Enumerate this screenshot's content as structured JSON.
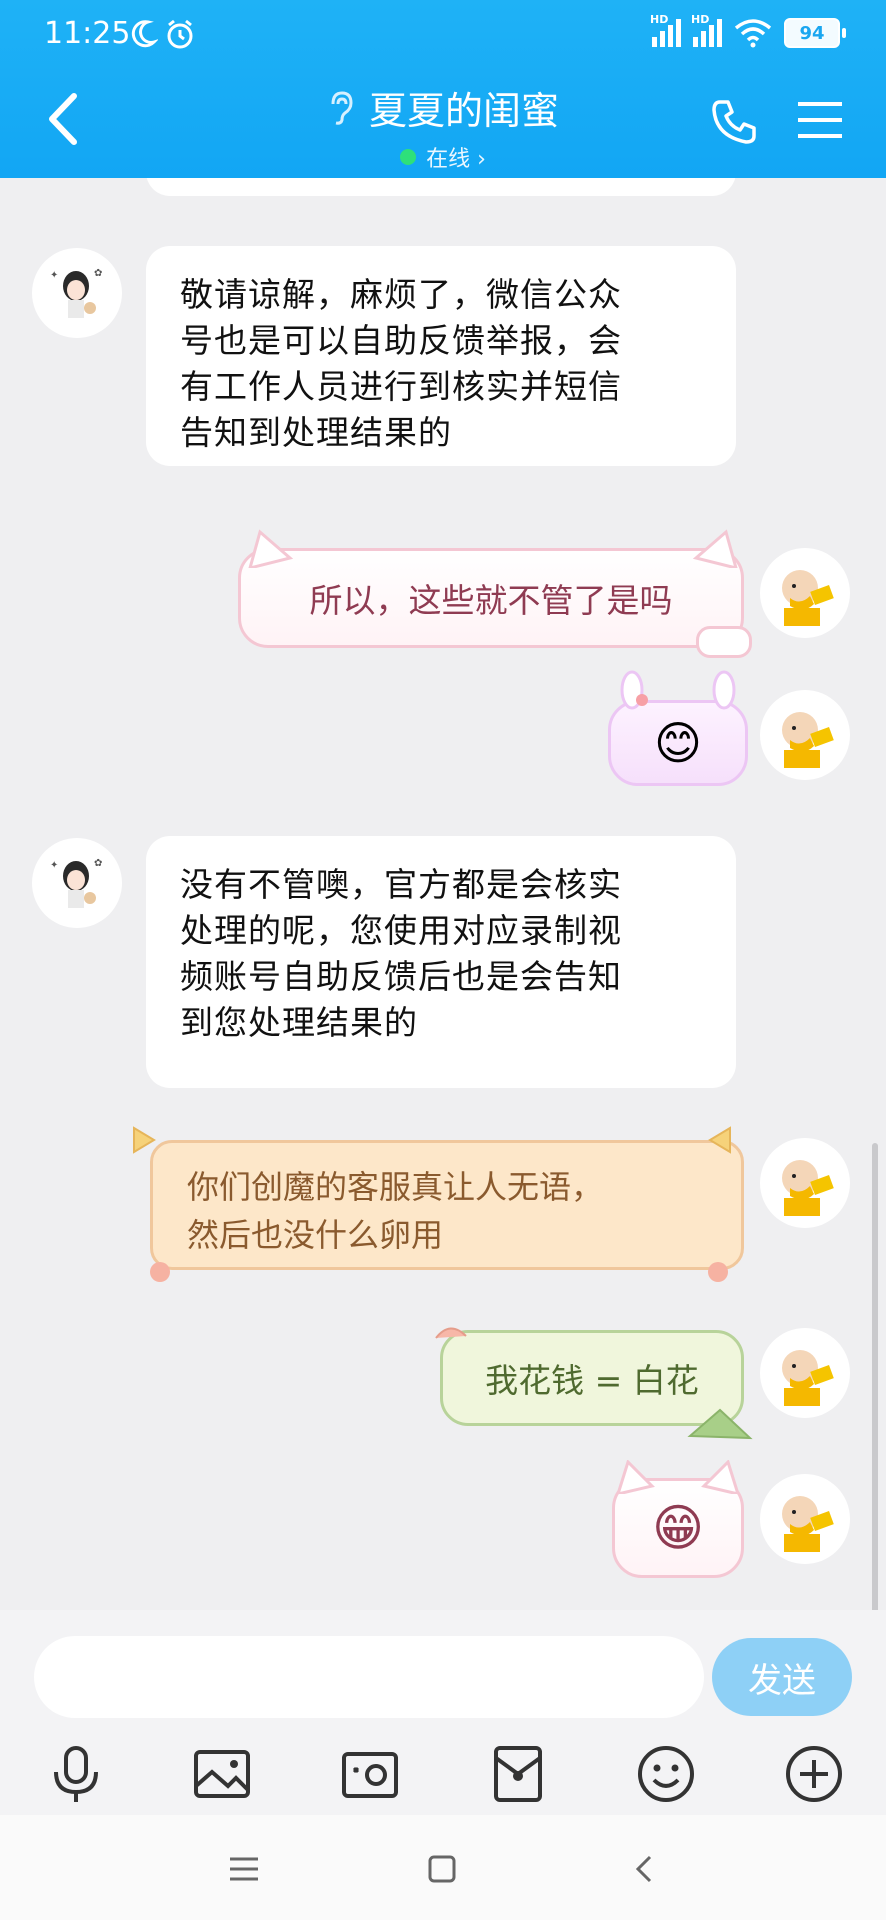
{
  "status": {
    "time": "11:25",
    "signal1": "HD",
    "signal2": "HD",
    "battery": "94"
  },
  "header": {
    "title": "夏夏的闺蜜",
    "subtitle": "在线 ›",
    "accent": "#12a6f4"
  },
  "messages": [
    {
      "side": "left",
      "text": "敬请谅解，麻烦了，微信公众\n号也是可以自助反馈举报，会\n有工作人员进行到核实并短信\n告知到处理结果的"
    },
    {
      "side": "right",
      "style": "pink-cat",
      "text": "所以，这些就不管了是吗"
    },
    {
      "side": "right",
      "style": "lilac-bunny",
      "emoji": "😊"
    },
    {
      "side": "left",
      "text": "没有不管噢，官方都是会核实\n处理的呢，您使用对应录制视\n频账号自助反馈后也是会告知\n到您处理结果的"
    },
    {
      "side": "right",
      "style": "orange",
      "text": "你们创魔的客服真让人无语，\n然后也没什么卵用"
    },
    {
      "side": "right",
      "style": "green",
      "text": "我花钱 = 白花"
    },
    {
      "side": "right",
      "style": "pink-cat",
      "emoji": "😁"
    }
  ],
  "input": {
    "placeholder": "",
    "send_label": "发送"
  },
  "toolbar": [
    "microphone-icon",
    "image-icon",
    "camera-icon",
    "red-packet-icon",
    "emoji-icon",
    "plus-icon"
  ],
  "navbar": [
    "menu-icon",
    "home-icon",
    "back-icon"
  ]
}
